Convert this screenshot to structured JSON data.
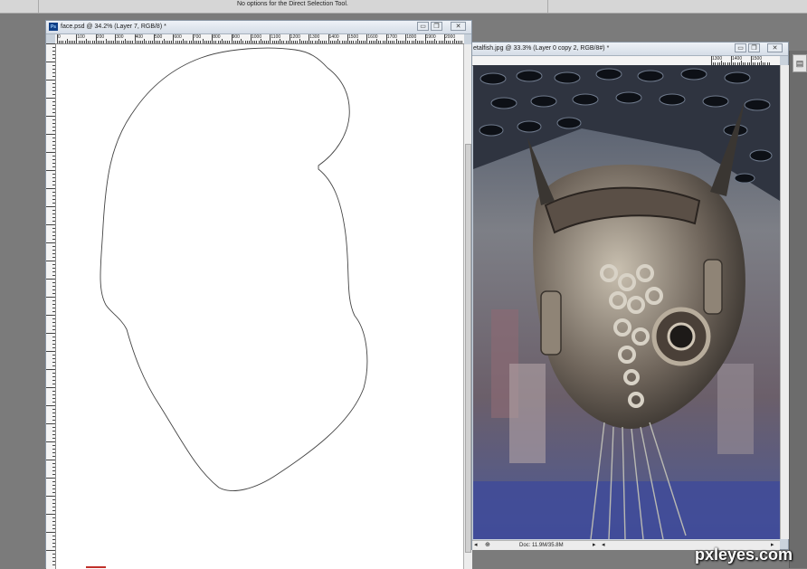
{
  "options_bar": {
    "message": "No options for the Direct Selection Tool."
  },
  "doc1": {
    "title": "face.psd @ 34.2% (Layer 7, RGB/8) *",
    "app_icon": "Ps",
    "ruler_numbers": [
      "0",
      "100",
      "200",
      "300",
      "400",
      "500",
      "600",
      "700",
      "800",
      "900",
      "1000",
      "1100",
      "1200",
      "1300",
      "1400",
      "1500",
      "1600",
      "1700",
      "1800",
      "1900",
      "2000"
    ]
  },
  "doc2": {
    "title": "etalfish.jpg @ 33.3% (Layer 0 copy 2, RGB/8#) *",
    "status_doc": "Doc: 11.9M/35.8M",
    "ruler_numbers": [
      "1300",
      "1400",
      "1500"
    ]
  },
  "window_buttons": {
    "minimize": "▭",
    "restore": "❐",
    "close": "✕"
  },
  "icons": {
    "ps_icon": "photoshop-icon",
    "panel": "panel-toggle-icon",
    "nav_left": "arrow-left-icon",
    "nav_right": "arrow-right-icon"
  },
  "watermark": "pxleyes.com"
}
